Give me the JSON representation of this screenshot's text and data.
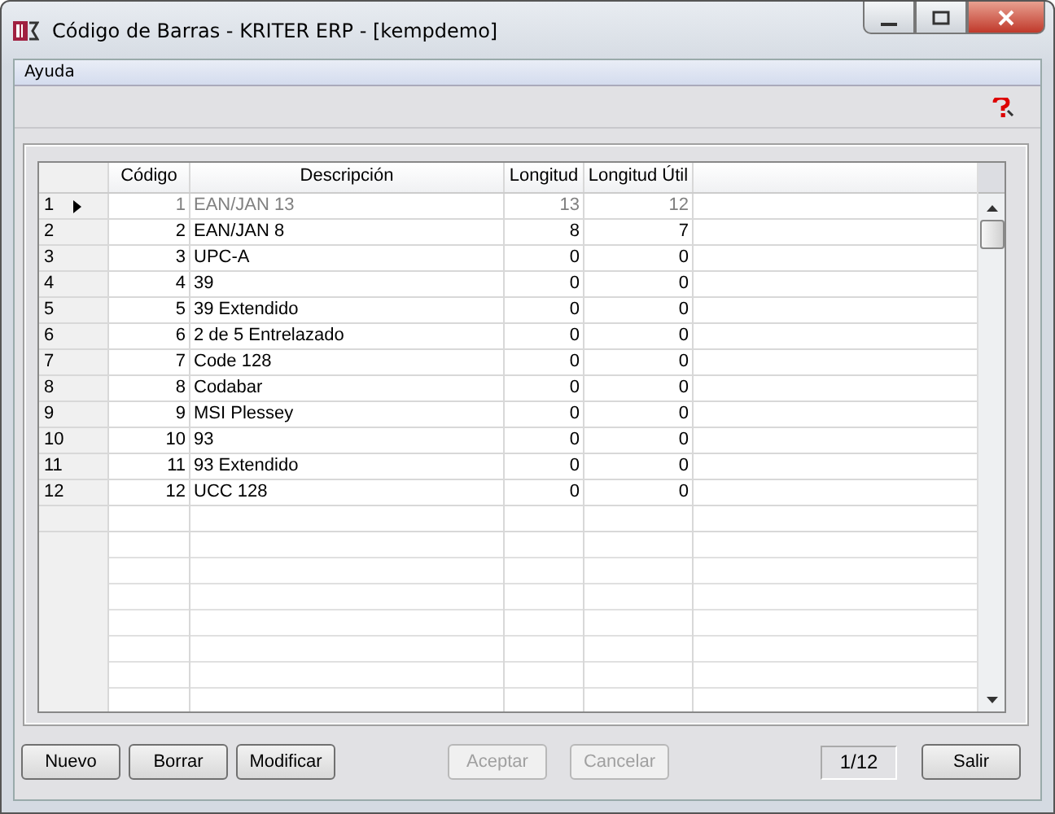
{
  "window": {
    "title": "Código de Barras - KRITER ERP - [kempdemo]"
  },
  "menu": [
    "Ayuda"
  ],
  "table": {
    "columns": [
      "Código",
      "Descripción",
      "Longitud",
      "Longitud Útil"
    ],
    "rows": [
      {
        "num": "1",
        "selected": true,
        "cells": [
          "1",
          "EAN/JAN 13",
          "13",
          "12"
        ]
      },
      {
        "num": "2",
        "selected": false,
        "cells": [
          "2",
          "EAN/JAN 8",
          "8",
          "7"
        ]
      },
      {
        "num": "3",
        "selected": false,
        "cells": [
          "3",
          "UPC-A",
          "0",
          "0"
        ]
      },
      {
        "num": "4",
        "selected": false,
        "cells": [
          "4",
          "39",
          "0",
          "0"
        ]
      },
      {
        "num": "5",
        "selected": false,
        "cells": [
          "5",
          "39 Extendido",
          "0",
          "0"
        ]
      },
      {
        "num": "6",
        "selected": false,
        "cells": [
          "6",
          "2 de 5 Entrelazado",
          "0",
          "0"
        ]
      },
      {
        "num": "7",
        "selected": false,
        "cells": [
          "7",
          "Code 128",
          "0",
          "0"
        ]
      },
      {
        "num": "8",
        "selected": false,
        "cells": [
          "8",
          "Codabar",
          "0",
          "0"
        ]
      },
      {
        "num": "9",
        "selected": false,
        "cells": [
          "9",
          "MSI Plessey",
          "0",
          "0"
        ]
      },
      {
        "num": "10",
        "selected": false,
        "cells": [
          "10",
          "93",
          "0",
          "0"
        ]
      },
      {
        "num": "11",
        "selected": false,
        "cells": [
          "11",
          "93 Extendido",
          "0",
          "0"
        ]
      },
      {
        "num": "12",
        "selected": false,
        "cells": [
          "12",
          "UCC 128",
          "0",
          "0"
        ]
      }
    ]
  },
  "buttons": [
    {
      "label": "Nuevo",
      "disabled": false
    },
    {
      "label": "Borrar",
      "disabled": false
    },
    {
      "label": "Modificar",
      "disabled": false
    },
    {
      "label": "Aceptar",
      "disabled": true
    },
    {
      "label": "Cancelar",
      "disabled": true
    }
  ],
  "record_counter": "1/12",
  "exit_button": {
    "label": "Salir",
    "disabled": false
  }
}
